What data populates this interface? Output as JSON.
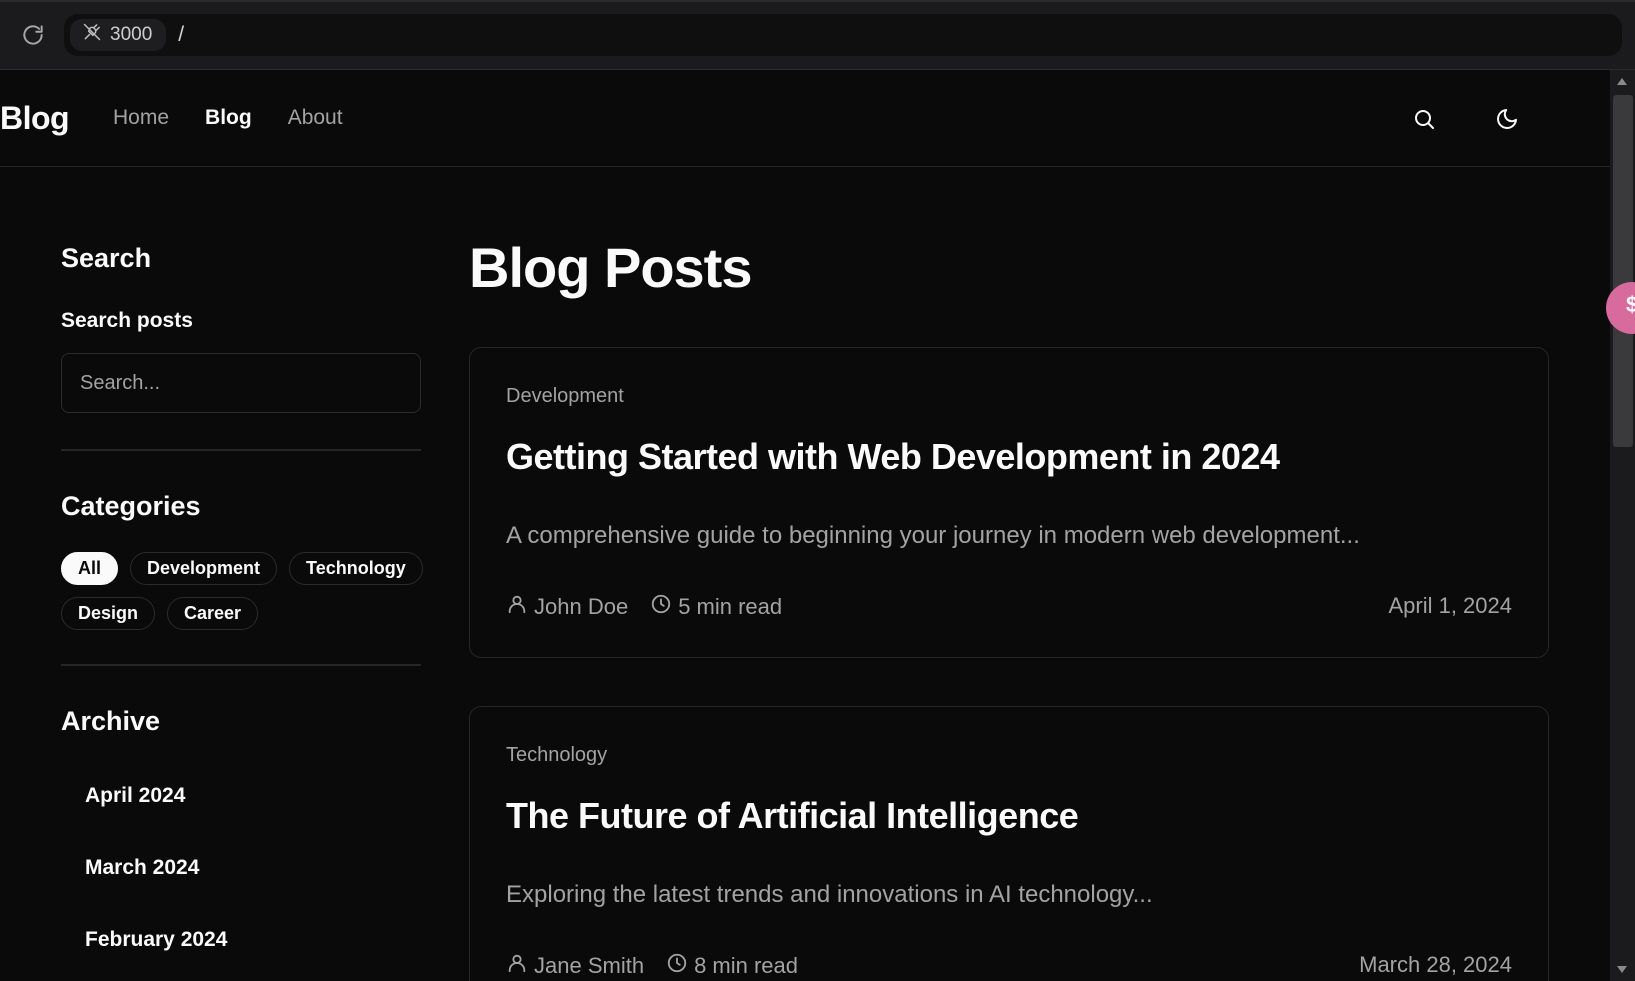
{
  "browser": {
    "port": "3000",
    "path": "/"
  },
  "header": {
    "brand": "Blog",
    "nav": [
      {
        "label": "Home"
      },
      {
        "label": "Blog"
      },
      {
        "label": "About"
      }
    ]
  },
  "sidebar": {
    "search_title": "Search",
    "search_label": "Search posts",
    "search_placeholder": "Search...",
    "categories_title": "Categories",
    "categories": [
      "All",
      "Development",
      "Technology",
      "Design",
      "Career"
    ],
    "archive_title": "Archive",
    "archive": [
      "April 2024",
      "March 2024",
      "February 2024"
    ]
  },
  "main": {
    "title": "Blog Posts",
    "posts": [
      {
        "category": "Development",
        "title": "Getting Started with Web Development in 2024",
        "excerpt": "A comprehensive guide to beginning your journey in modern web development...",
        "author": "John Doe",
        "read_time": "5 min read",
        "date": "April 1, 2024"
      },
      {
        "category": "Technology",
        "title": "The Future of Artificial Intelligence",
        "excerpt": "Exploring the latest trends and innovations in AI technology...",
        "author": "Jane Smith",
        "read_time": "8 min read",
        "date": "March 28, 2024"
      }
    ]
  },
  "icons": {
    "reload": "reload-icon",
    "plug": "plug-icon",
    "search": "search-icon",
    "theme": "moon-icon",
    "author": "user-icon",
    "time": "clock-icon"
  }
}
